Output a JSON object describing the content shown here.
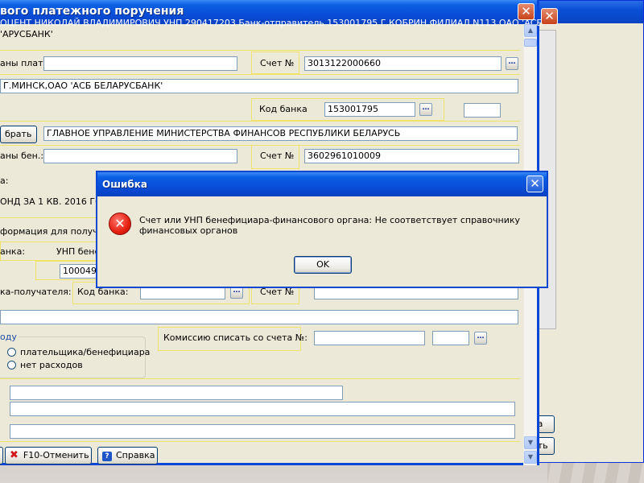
{
  "main_window": {
    "title": "вого платежного поручения",
    "header_line1": "ОЦЕНТ НИКОЛАЙ ВЛАДИМИРОВИЧ УНП 290417203 Банк-отправитель 153001795 Г.КОБРИН,ФИЛИАЛ N113 ОАО 'АСБ",
    "header_line2": "'АРУСБАНК'",
    "payer_country_label": "аны плат.:",
    "payer_country_value": "",
    "account_label_1": "Счет №",
    "account_value_1": "3013122000660",
    "bank_name_value": "Г.МИНСК,ОАО 'АСБ БЕЛАРУСБАНК'",
    "bank_code_label": "Код банка",
    "bank_code_value": "153001795",
    "bank_code_extra": "",
    "select_button": "брать",
    "beneficiary_value": "ГЛАВНОЕ УПРАВЛЕНИЕ МИНИСТЕРСТВА ФИНАНСОВ РЕСПУБЛИКИ БЕЛАРУСЬ",
    "beneficiary_country_label": "аны бен.:",
    "beneficiary_country_value": "",
    "account_label_2": "Счет №",
    "account_value_2": "3602961010009",
    "purpose_label": "а:",
    "purpose_text": "ОНД ЗА 1 КВ. 2016 ГО",
    "info_label": "формация для получате",
    "bank_label_short": "анка:",
    "unp_ben_label": "УНП бене",
    "unp_ben_value": "1000498",
    "recipient_bank_label": "ка-получателя:",
    "bank_code_label_2": "Код банка:",
    "bank_code_value_2": "",
    "account_label_3": "Счет №",
    "account_value_3": "",
    "expenses_group_label": "оду",
    "radio_option_1": "плательщика/бенефициара",
    "radio_option_2": "нет расходов",
    "commission_label": "Комиссию списать со счета №:",
    "commission_account": "",
    "commission_extra": "",
    "cancel_button": "F10-Отменить",
    "help_button": "Справка"
  },
  "background_window": {
    "button_1_fragment": "ка",
    "button_2_fragment": "ать"
  },
  "dialog": {
    "title": "Ошибка",
    "message": "Счет или УНП бенефициара-финансового органа: Не соответствует справочнику финансовых органов",
    "ok_button": "OK"
  },
  "colors": {
    "titlebar": "#0a4ed8",
    "window_bg": "#ece9d8",
    "field_border": "#7f9db9",
    "section_border": "#f0e36a",
    "error_icon": "#e52012"
  },
  "icons": {
    "error": "error-icon",
    "close": "close-icon",
    "cancel": "red-x-icon",
    "help": "question-icon",
    "lookup": "ellipsis-icon"
  }
}
